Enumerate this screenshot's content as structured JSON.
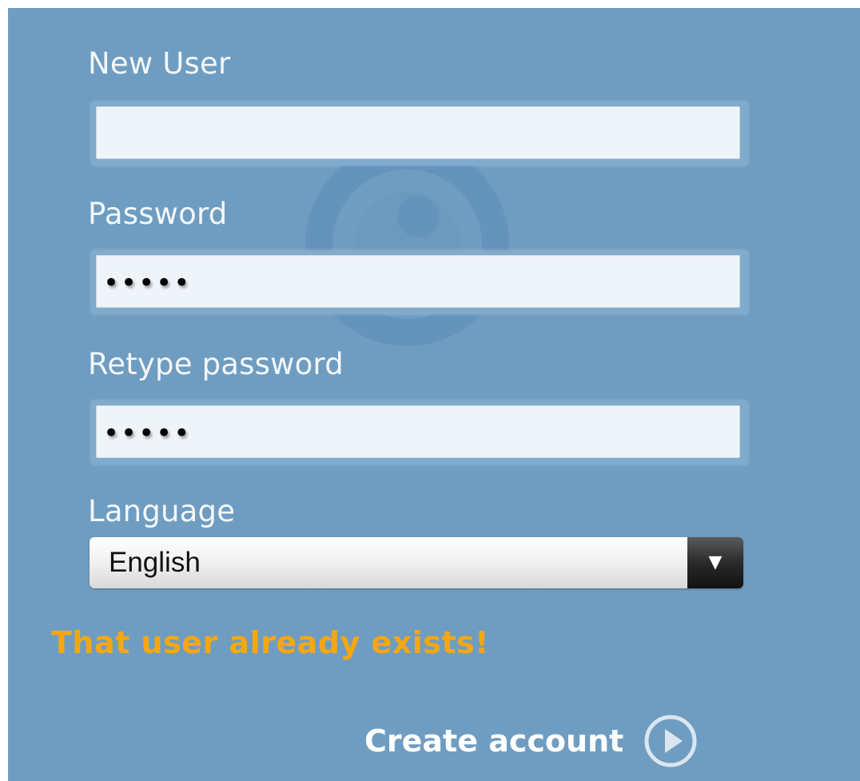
{
  "form": {
    "username": {
      "label": "New User",
      "value": ""
    },
    "password": {
      "label": "Password",
      "value": "•••••"
    },
    "retype_password": {
      "label": "Retype password",
      "value": "•••••"
    },
    "language": {
      "label": "Language",
      "selected": "English",
      "arrow": "▼"
    }
  },
  "error_message": "That user already exists!",
  "submit": {
    "label": "Create account",
    "icon": "play-circle-icon"
  },
  "colors": {
    "panel_bg": "#6f9dc1",
    "error": "#f5a712",
    "input_bg": "#eff4f9"
  }
}
